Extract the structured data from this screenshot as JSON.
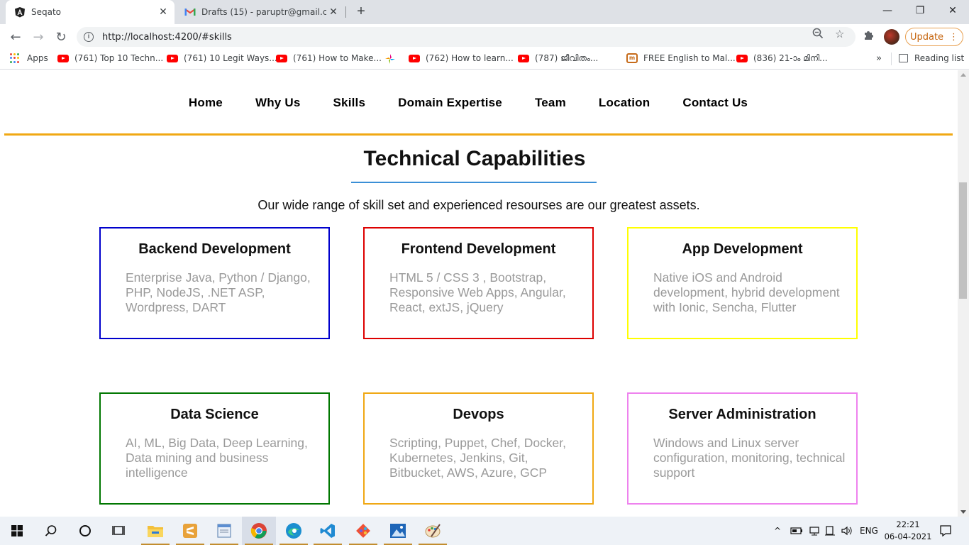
{
  "browser": {
    "tabs": [
      {
        "title": "Seqato",
        "icon": "angular-icon",
        "active": true
      },
      {
        "title": "Drafts (15) - paruptr@gmail.com",
        "icon": "gmail-icon",
        "active": false
      }
    ],
    "url": "http://localhost:4200/#skills",
    "update_label": "Update",
    "bookmarks": [
      {
        "label": "Apps",
        "icon": "apps-grid-icon"
      },
      {
        "label": "(761) Top 10 Techn...",
        "icon": "youtube-icon"
      },
      {
        "label": "(761) 10 Legit Ways...",
        "icon": "youtube-icon"
      },
      {
        "label": "(761) How to Make...",
        "icon": "youtube-icon"
      },
      {
        "label": "",
        "icon": "pinwheel-icon"
      },
      {
        "label": "(762) How to learn...",
        "icon": "youtube-icon"
      },
      {
        "label": "(787) ജീവിതം...",
        "icon": "youtube-icon"
      },
      {
        "label": "FREE English to Mal...",
        "icon": "dictionary-icon"
      },
      {
        "label": "(836) 21-ാം മിനി...",
        "icon": "youtube-icon"
      }
    ],
    "more_bookmarks": "»",
    "reading_list": "Reading list"
  },
  "site": {
    "nav": [
      "Home",
      "Why Us",
      "Skills",
      "Domain Expertise",
      "Team",
      "Location",
      "Contact Us"
    ],
    "heading": "Technical Capabilities",
    "subtitle": "Our wide range of skill set and experienced resourses are our greatest assets.",
    "cards": [
      {
        "title": "Backend Development",
        "body": "Enterprise Java, Python / Django, PHP, NodeJS, .NET ASP, Wordpress, DART",
        "border": "#0000cc"
      },
      {
        "title": "Frontend Development",
        "body": "HTML 5 / CSS 3 , Bootstrap, Responsive Web Apps, Angular, React, extJS, jQuery",
        "border": "#dd0000"
      },
      {
        "title": "App Development",
        "body": "Native iOS and Android development, hybrid development with Ionic, Sencha, Flutter",
        "border": "#ffff00"
      },
      {
        "title": "Data Science",
        "body": "AI, ML, Big Data, Deep Learning, Data mining and business intelligence",
        "border": "#007700"
      },
      {
        "title": "Devops",
        "body": "Scripting, Puppet, Chef, Docker, Kubernetes, Jenkins, Git, Bitbucket, AWS, Azure, GCP",
        "border": "#f0a814"
      },
      {
        "title": "Server Administration",
        "body": "Windows and Linux server configuration, monitoring, technical support",
        "border": "#ee82ee"
      }
    ]
  },
  "taskbar": {
    "language": "ENG",
    "time": "22:21",
    "date": "06-04-2021"
  },
  "colors": {
    "accent_orange": "#f0a814",
    "heading_underline": "#3a8fd6",
    "card_text_gray": "#9a9a9a"
  }
}
